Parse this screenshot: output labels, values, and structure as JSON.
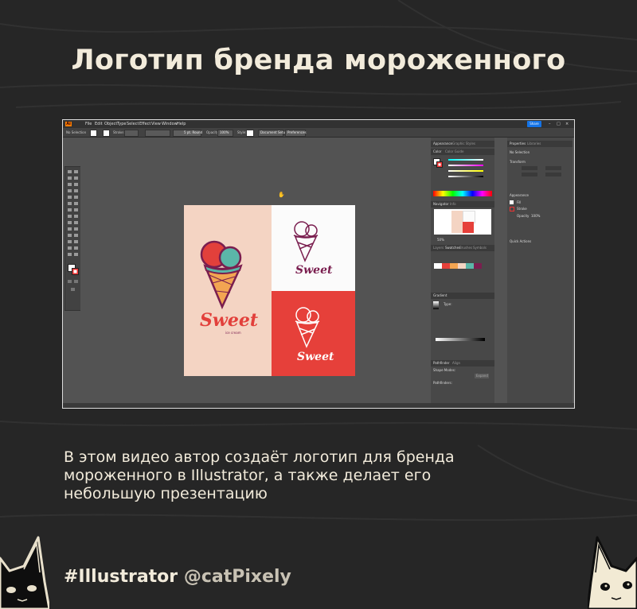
{
  "page": {
    "title": "Логотип бренда мороженного",
    "description_lines": [
      "В этом видео автор создаёт логотип для бренда",
      "мороженного в Illustrator, а также делает его",
      "небольшую презентацию"
    ],
    "hashtag": "#Illustrator",
    "handle": "@catPixely"
  },
  "illustrator": {
    "app_logo": "Ai",
    "menu": [
      "File",
      "Edit",
      "Object",
      "Type",
      "Select",
      "Effect",
      "View",
      "Window",
      "Help"
    ],
    "share_button": "Share",
    "control_bar": {
      "selection": "No Selection",
      "stroke_label": "Stroke:",
      "brush": "5 pt. Round",
      "opacity_label": "Opacity:",
      "opacity_value": "100%",
      "style_label": "Style:",
      "document_setup": "Document Setup",
      "preferences": "Preferences"
    },
    "panels": {
      "appearance_tab": "Appearance",
      "graphic_styles_tab": "Graphic Styles",
      "color_tab": "Color",
      "color_guide_tab": "Color Guide",
      "navigator_tab": "Navigator",
      "info_tab": "Info",
      "zoom": "50%",
      "swatches_tab": "Swatches",
      "brushes_tab": "Brushes",
      "symbols_tab": "Symbols",
      "layers_tab": "Layers",
      "gradient_tab": "Gradient",
      "type_label": "Type:",
      "pathfinder_tab": "Pathfinder",
      "align_tab": "Align",
      "shape_modes": "Shape Modes:",
      "pathfinders": "Pathfinders:",
      "expand": "Expand"
    },
    "properties": {
      "properties_tab": "Properties",
      "libraries_tab": "Libraries",
      "no_selection": "No Selection",
      "transform": "Transform",
      "appearance": "Appearance",
      "fill": "Fill",
      "stroke": "Stroke",
      "opacity": "Opacity",
      "opacity_value": "100%",
      "quick_actions": "Quick Actions"
    },
    "artwork": {
      "logo_word": "Sweet",
      "logo_tagline": "ice cream",
      "colors": {
        "peach_bg": "#f4d4c3",
        "white_bg": "#fbfbfb",
        "red_bg": "#e6403a",
        "scoop_red": "#e2403b",
        "scoop_teal": "#5bb6a8",
        "cone": "#f3a552",
        "outline_plum": "#7a1e4f",
        "logo_red": "#e2403b"
      }
    }
  }
}
